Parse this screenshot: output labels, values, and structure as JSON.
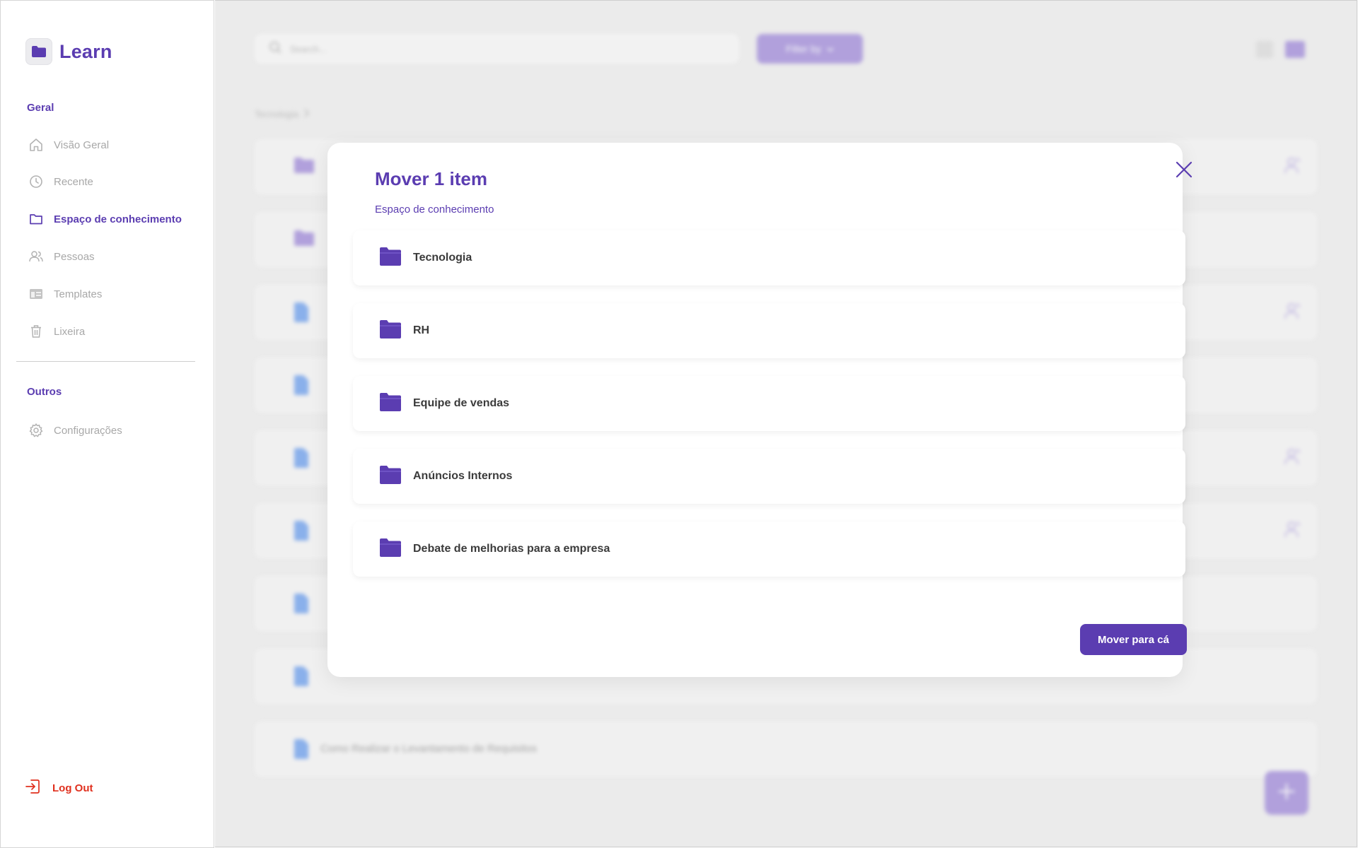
{
  "app": {
    "name": "Learn"
  },
  "sidebar": {
    "section_general": "Geral",
    "items": [
      {
        "label": "Visão Geral",
        "icon": "home-icon"
      },
      {
        "label": "Recente",
        "icon": "clock-icon"
      },
      {
        "label": "Espaço de conhecimento",
        "icon": "folder-icon",
        "active": true
      },
      {
        "label": "Pessoas",
        "icon": "people-icon"
      },
      {
        "label": "Templates",
        "icon": "template-icon"
      },
      {
        "label": "Lixeira",
        "icon": "trash-icon"
      }
    ],
    "section_other": "Outros",
    "other_items": [
      {
        "label": "Configurações",
        "icon": "gear-icon"
      }
    ],
    "logout": "Log Out"
  },
  "main": {
    "search_placeholder": "Search...",
    "filter_label": "Filter by",
    "breadcrumb": "Tecnologia",
    "last_row_name": "Como Realizar o Levantamento de Requisitos"
  },
  "modal": {
    "title": "Mover 1 item",
    "subtitle": "Espaço de conhecimento",
    "folders": [
      {
        "name": "Tecnologia"
      },
      {
        "name": "RH"
      },
      {
        "name": "Equipe de vendas"
      },
      {
        "name": "Anúncios Internos"
      },
      {
        "name": "Debate de melhorias para a empresa"
      }
    ],
    "confirm_label": "Mover para cá"
  },
  "colors": {
    "accent": "#5b3db1",
    "accent_light": "#b7a6e4",
    "logout": "#e0301e",
    "doc_blue": "#8fb6f3"
  }
}
